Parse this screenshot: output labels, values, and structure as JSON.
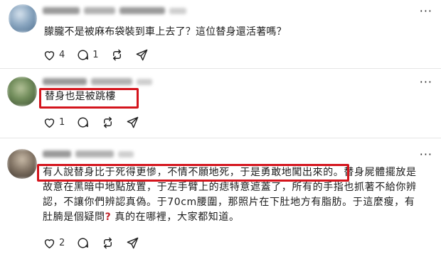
{
  "comments": [
    {
      "text": "朦朧不是被麻布袋裝到車上去了？這位替身還活著嗎？",
      "more": "···",
      "actions": {
        "like_count": "4",
        "reply_count": "1"
      }
    },
    {
      "text": "替身也是被跳樓",
      "more": "···",
      "actions": {
        "like_count": "1",
        "reply_count": ""
      }
    },
    {
      "lines": [
        "有人說替身比于死得更慘，不情不願地死，于是勇敢地闖出來的。替身屍體擺放是",
        "故意在黑暗中地點放置，于左手臂上的痣特意遮蓋了，所有的手指也抓著不給你辨",
        "認，不讓你們辨認真偽。于70cm腰圍，那照片在下肚地方有脂肪。于這麼瘦，有",
        "肚腩是個疑問"
      ],
      "line4_tail": " 真的在哪裡，大家都知道。",
      "question_mark": "?",
      "more": "···",
      "actions": {
        "like_count": "2",
        "reply_count": ""
      }
    }
  ],
  "colors": {
    "highlight": "#d4141c",
    "question_mark": "#c1272d"
  },
  "icons": [
    "heart-icon",
    "comment-icon",
    "repost-icon",
    "share-icon"
  ]
}
